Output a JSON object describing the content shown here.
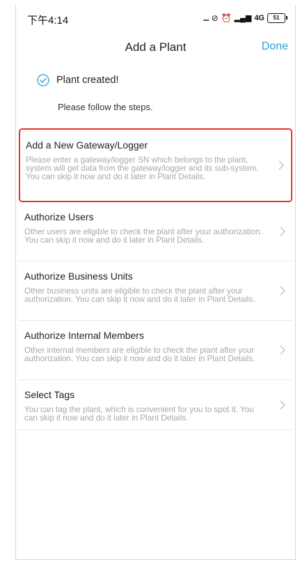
{
  "status_bar": {
    "time": "下午4:14",
    "signal_dots": "...",
    "network_label": "4G",
    "battery_level": "51"
  },
  "header": {
    "title": "Add a Plant",
    "done_label": "Done"
  },
  "success": {
    "message": "Plant created!",
    "subtext": "Please follow the steps."
  },
  "steps": [
    {
      "title": "Add a New Gateway/Logger",
      "description": "Please enter a gateway/logger SN which belongs to the plant, system will get data from the gateway/logger and its sub-system. You can skip it now and do it later in Plant Details.",
      "highlighted": true
    },
    {
      "title": "Authorize Users",
      "description": "Other users are eligible to check the plant after your authorization. You can skip it now and do it later in Plant Details.",
      "highlighted": false
    },
    {
      "title": "Authorize Business Units",
      "description": "Other business units are eligible to check the plant after your authorization. You can skip it now and do it later in Plant Details.",
      "highlighted": false
    },
    {
      "title": "Authorize Internal Members",
      "description": "Other internal members are eligible to check the plant after your authorization. You can skip it now and do it later in Plant Details.",
      "highlighted": false
    },
    {
      "title": "Select Tags",
      "description": "You can tag the plant, which is convenient for you to spot it. You can skip it now and do it later in Plant Details.",
      "highlighted": false
    }
  ],
  "colors": {
    "accent": "#2a9fd6",
    "highlight_border": "#e5322f",
    "description_text": "#a8a8a8"
  }
}
